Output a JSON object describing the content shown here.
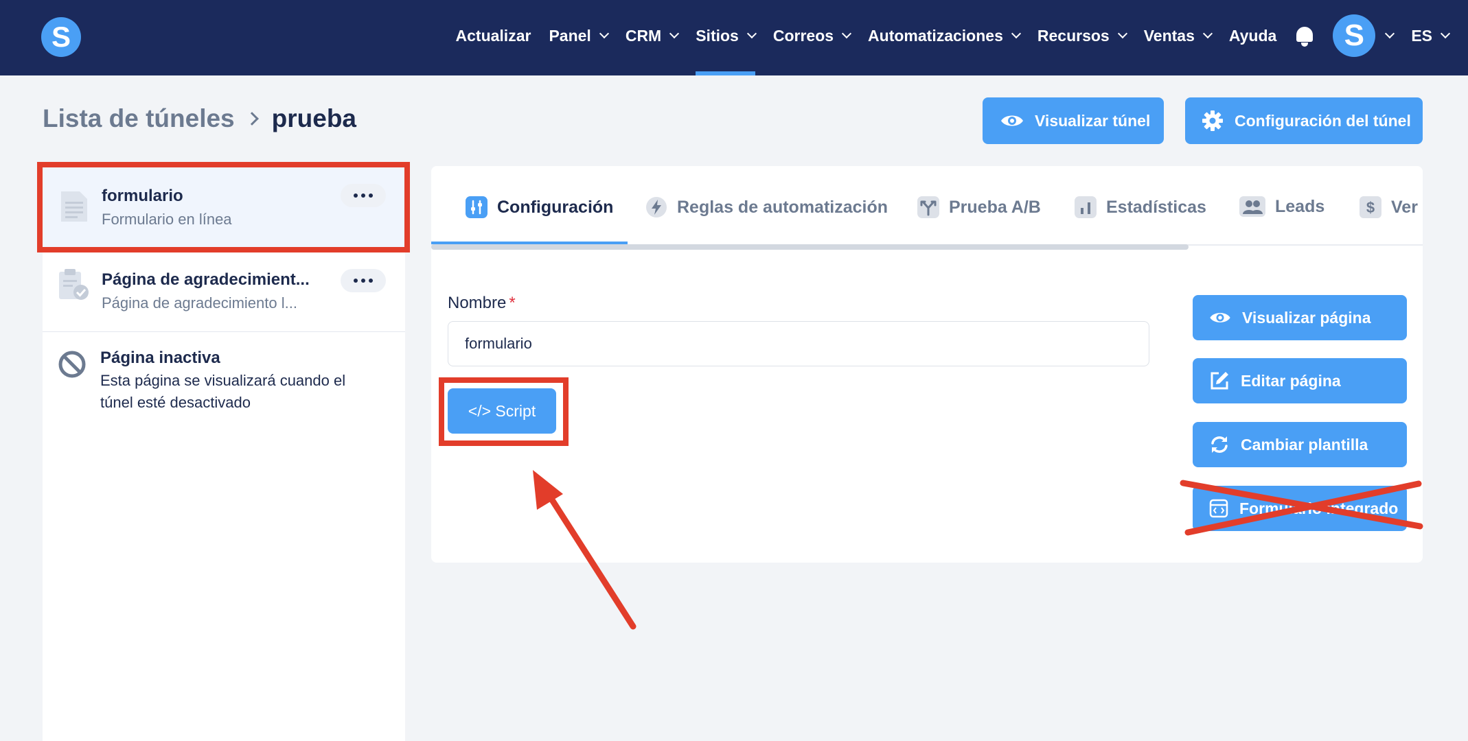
{
  "nav": {
    "logo_letter": "S",
    "items": [
      {
        "label": "Actualizar",
        "dropdown": false
      },
      {
        "label": "Panel",
        "dropdown": true
      },
      {
        "label": "CRM",
        "dropdown": true
      },
      {
        "label": "Sitios",
        "dropdown": true,
        "active": true
      },
      {
        "label": "Correos",
        "dropdown": true
      },
      {
        "label": "Automatizaciones",
        "dropdown": true
      },
      {
        "label": "Recursos",
        "dropdown": true
      },
      {
        "label": "Ventas",
        "dropdown": true
      },
      {
        "label": "Ayuda",
        "dropdown": false
      }
    ],
    "avatar_letter": "S",
    "language": "ES"
  },
  "breadcrumb": {
    "parent": "Lista de túneles",
    "current": "prueba"
  },
  "header_buttons": {
    "preview_funnel": "Visualizar túnel",
    "funnel_settings": "Configuración del túnel"
  },
  "sidebar": {
    "items": [
      {
        "title": "formulario",
        "subtitle": "Formulario en línea",
        "icon": "document-icon"
      },
      {
        "title": "Página de agradecimient...",
        "subtitle": "Página de agradecimiento l...",
        "icon": "clipboard-check-icon"
      },
      {
        "title": "Página inactiva",
        "subtitle_line1": "Esta página se visualizará cuando el",
        "subtitle_line2": "túnel esté desactivado",
        "icon": "ban-icon"
      }
    ]
  },
  "tabs": [
    {
      "label": "Configuración",
      "icon": "sliders-icon",
      "active": true
    },
    {
      "label": "Reglas de automatización",
      "icon": "bolt-icon"
    },
    {
      "label": "Prueba A/B",
      "icon": "split-icon"
    },
    {
      "label": "Estadísticas",
      "icon": "bar-chart-icon"
    },
    {
      "label": "Leads",
      "icon": "users-icon"
    },
    {
      "label": "Ver",
      "icon": "dollar-icon"
    }
  ],
  "form": {
    "name_label": "Nombre",
    "required_mark": "*",
    "name_value": "formulario",
    "script_button": "</> Script"
  },
  "page_actions": {
    "preview_page": "Visualizar página",
    "edit_page": "Editar página",
    "change_template": "Cambiar plantilla",
    "embedded_form": "Formulario integrado"
  },
  "colors": {
    "nav_bg": "#1b2a5c",
    "accent": "#4a9ff5",
    "annotation": "#e23d2a",
    "page_bg": "#f2f4f7"
  }
}
